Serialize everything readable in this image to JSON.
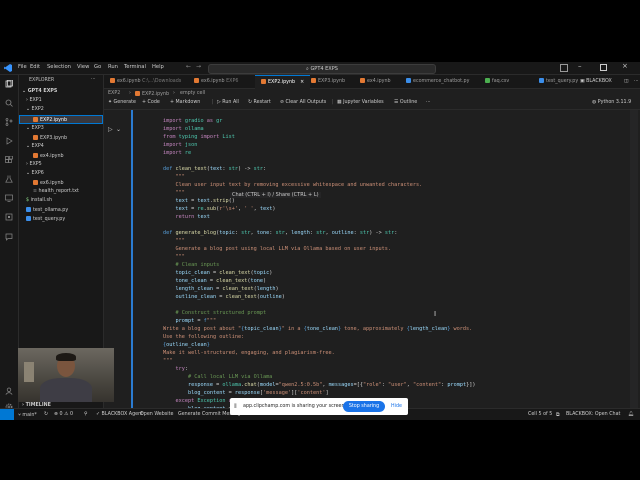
{
  "menu": [
    "File",
    "Edit",
    "Selection",
    "View",
    "Go",
    "Run",
    "Terminal",
    "Help"
  ],
  "search_label": "GPT4 EXPS",
  "explorer": {
    "header": "EXPLORER",
    "root": "GPT4 EXPS",
    "items": [
      {
        "label": "EXP1",
        "type": "folder"
      },
      {
        "label": "EXP2",
        "type": "folder"
      },
      {
        "label": "EXP2.ipynb",
        "type": "nb"
      },
      {
        "label": "EXP3",
        "type": "folder"
      },
      {
        "label": "EXP3.ipynb",
        "type": "nb"
      },
      {
        "label": "EXP4",
        "type": "folder"
      },
      {
        "label": "ex4.ipynb",
        "type": "nb"
      },
      {
        "label": "EXP5",
        "type": "folder"
      },
      {
        "label": "EXP6",
        "type": "folder"
      },
      {
        "label": "ex6.ipynb",
        "type": "nb"
      },
      {
        "label": "health_report.txt",
        "type": "txt"
      },
      {
        "label": "install.sh",
        "type": "sh"
      },
      {
        "label": "test_ollama.py",
        "type": "py"
      },
      {
        "label": "test_query.py",
        "type": "py"
      }
    ],
    "timeline": "TIMELINE"
  },
  "tabs": [
    {
      "label": "ex6.ipynb",
      "suffix": "C:\\...\\Downloads",
      "icon": "nb"
    },
    {
      "label": "ex6.ipynb",
      "suffix": "EXP6",
      "icon": "nb"
    },
    {
      "label": "EXP2.ipynb",
      "suffix": "",
      "icon": "nb",
      "active": true
    },
    {
      "label": "EXP3.ipynb",
      "suffix": "",
      "icon": "nb"
    },
    {
      "label": "ex4.ipynb",
      "suffix": "",
      "icon": "nb"
    },
    {
      "label": "ecommerce_chatbot.py",
      "suffix": "",
      "icon": "py"
    },
    {
      "label": "faq.csv",
      "suffix": "",
      "icon": "csv"
    },
    {
      "label": "test_query.py",
      "suffix": "",
      "icon": "py"
    }
  ],
  "topright_label": "BLACKBOX",
  "breadcrumbs": [
    "EXP2",
    "EXP2.ipynb",
    "empty cell"
  ],
  "toolbar": {
    "generate": "Generate",
    "code": "Code",
    "markdown": "Markdown",
    "run_all": "Run All",
    "restart": "Restart",
    "clear": "Clear All Outputs",
    "variables": "Jupyter Variables",
    "outline": "Outline",
    "kernel": "Python 3.11.9"
  },
  "hint": "Chat (CTRL + I) / Share (CTRL + L)",
  "status": {
    "branch": "main*",
    "errors": "0",
    "warnings": "0",
    "blackbox": "BLACKBOX Agent",
    "open_website": "Open Website",
    "commit": "Generate Commit Message",
    "cell": "Cell 5 of 5",
    "chat": "BLACKBOX: Open Chat"
  },
  "share_banner": {
    "text": "app.clipchamp.com is sharing your screen.",
    "stop": "Stop sharing",
    "hide": "Hide"
  }
}
